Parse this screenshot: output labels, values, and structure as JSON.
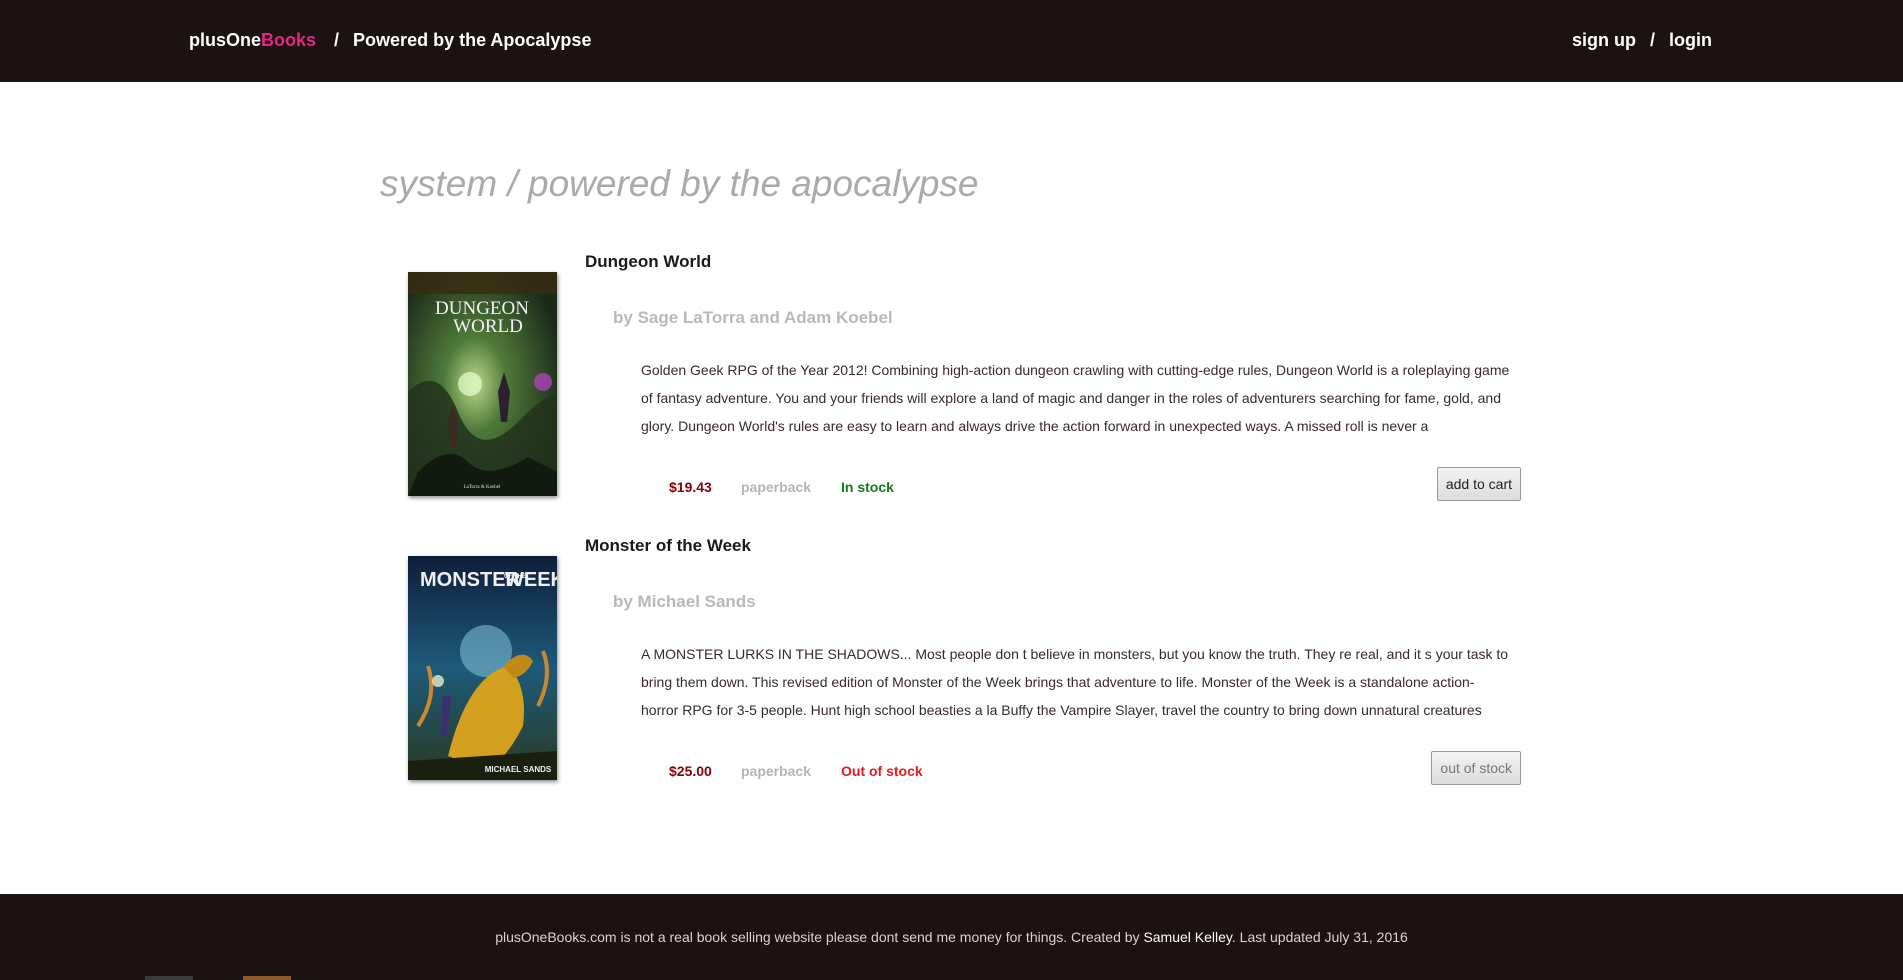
{
  "header": {
    "brand_part1": "plusOne",
    "brand_part2": "Books",
    "separator": "/",
    "current_page": "Powered by the Apocalypse",
    "signup_label": "sign up",
    "auth_separator": "/",
    "login_label": "login"
  },
  "system_heading": "system / powered by the apocalypse",
  "books": [
    {
      "title": "Dungeon World",
      "author": "by Sage LaTorra and Adam Koebel",
      "description": "Golden Geek RPG of the Year 2012! Combining high-action dungeon crawling with cutting-edge rules, Dungeon World is a roleplaying game of fantasy adventure. You and your friends will explore a land of magic and danger in the roles of adventurers searching for fame, gold, and glory. Dungeon World's rules are easy to learn and always drive the action forward in unexpected ways. A missed roll is never a",
      "price": "$19.43",
      "format": "paperback",
      "stock": "In stock",
      "button_label": "add to cart",
      "cover": {
        "title_line1": "DUNGEON",
        "title_line2": "WORLD",
        "credit": "LaTorra & Koebel",
        "icon": "book-cover-fantasy"
      }
    },
    {
      "title": "Monster of the Week",
      "author": "by Michael Sands",
      "description": "A MONSTER LURKS IN THE SHADOWS... Most people don t believe in monsters, but you know the truth. They re real, and it s your task to bring them down. This revised edition of Monster of the Week brings that adventure to life. Monster of the Week is a standalone action-horror RPG for 3-5 people. Hunt high school beasties a la Buffy the Vampire Slayer, travel the country to bring down unnatural creatures",
      "price": "$25.00",
      "format": "paperback",
      "stock": "Out of stock",
      "button_label": "out of stock",
      "cover": {
        "title_line1": "MONSTER",
        "title_small": "OF THE",
        "title_line2": "WEEK",
        "credit": "MICHAEL SANDS",
        "icon": "book-cover-monster"
      }
    }
  ],
  "footer": {
    "text_before": "plusOneBooks.com is not a real book selling website please dont send me money for things. Created by ",
    "author_link": "Samuel Kelley",
    "text_after": ". Last updated July 31, 2016"
  },
  "colors": {
    "header_bg": "#1b1212",
    "brand_accent": "#e6267f",
    "price": "#8b0000",
    "in_stock": "#1a7a1a",
    "out_of_stock": "#e41b1b"
  }
}
